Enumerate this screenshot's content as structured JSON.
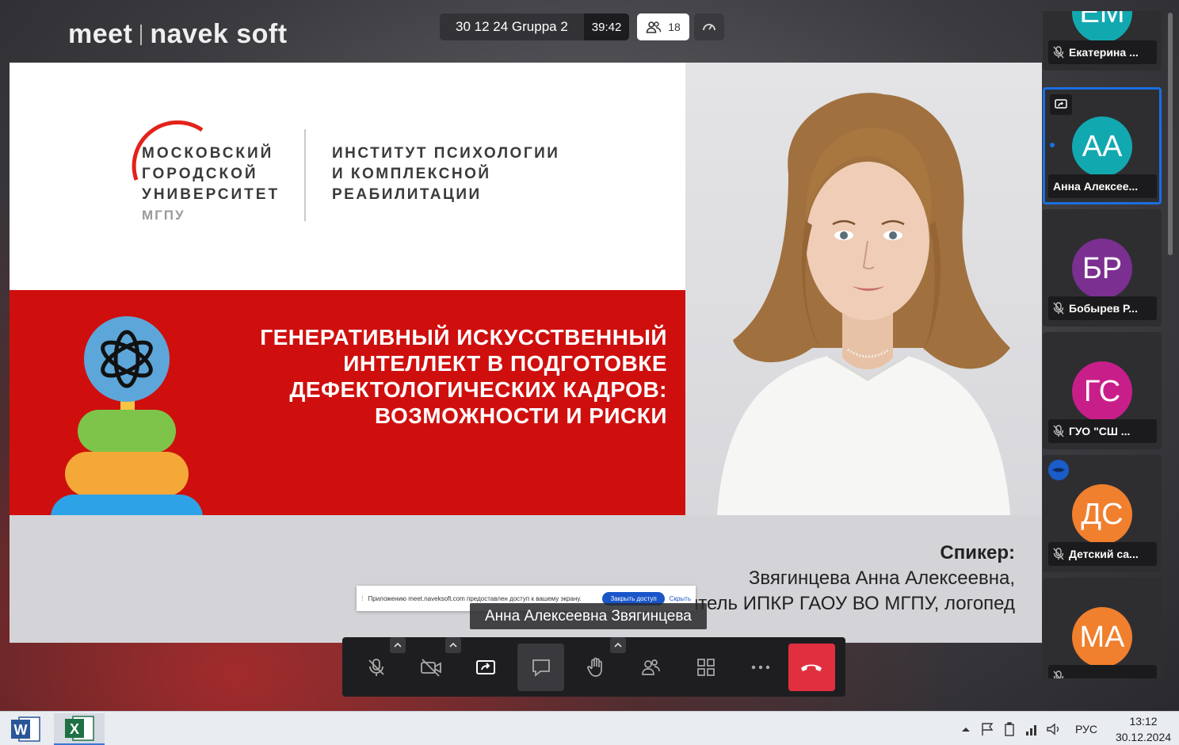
{
  "app": {
    "logo_left": "meet",
    "logo_right": "navek soft"
  },
  "header": {
    "meeting_name": "30 12 24 Gruppa 2",
    "elapsed": "39:42",
    "participant_count": "18"
  },
  "slide": {
    "university_lines": [
      "МОСКОВСКИЙ",
      "ГОРОДСКОЙ",
      "УНИВЕРСИТЕТ"
    ],
    "university_short": "МГПУ",
    "institute_lines": [
      "ИНСТИТУТ ПСИХОЛОГИИ",
      "И КОМПЛЕКСНОЙ",
      "РЕАБИЛИТАЦИИ"
    ],
    "title_lines": [
      "ГЕНЕРАТИВНЫЙ ИСКУССТВЕННЫЙ",
      "ИНТЕЛЛЕКТ В ПОДГОТОВКЕ",
      "ДЕФЕКТОЛОГИЧЕСКИХ КАДРОВ:",
      "ВОЗМОЖНОСТИ И РИСКИ"
    ],
    "speaker_label": "Спикер:",
    "speaker_name": "Звягинцева Анна Алексеевна,",
    "speaker_role": "ятель ИПКР ГАОУ ВО МГПУ, логопед",
    "colors": {
      "red": "#cf0f0e"
    }
  },
  "share_notice": {
    "text": "Приложению meet.naveksoft.com предоставлен доступ к вашему экрану.",
    "stop_label": "Закрыть доступ",
    "hide_label": "Скрыть"
  },
  "active_speaker": "Анна Алексеевна Звягинцева",
  "participants": [
    {
      "initials": "ЕМ",
      "name": "Екатерина ...",
      "color": "#12a8b0",
      "muted": true
    },
    {
      "initials": "АА",
      "name": "Анна Алексее...",
      "color": "#12a8b0",
      "muted": false,
      "sharing": true
    },
    {
      "initials": "БР",
      "name": "Бобырев Р...",
      "color": "#7b2f91",
      "muted": true
    },
    {
      "initials": "ГС",
      "name": "ГУО \"СШ ...",
      "color": "#c81e8a",
      "muted": true
    },
    {
      "initials": "ДС",
      "name": "Детский са...",
      "color": "#f07f2e",
      "muted": true
    },
    {
      "initials": "МА",
      "name": "",
      "color": "#f07f2e",
      "muted": true
    }
  ],
  "taskbar": {
    "lang": "РУС",
    "time": "13:12",
    "date": "30.12.2024"
  }
}
